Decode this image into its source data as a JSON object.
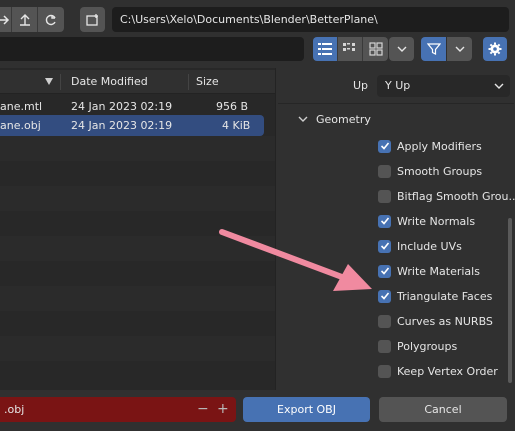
{
  "toolbar": {
    "path": "C:\\Users\\Xelo\\Documents\\Blender\\BetterPlane\\",
    "filter_value": ""
  },
  "filelist": {
    "columns": [
      "Date Modified",
      "Size"
    ],
    "rows": [
      {
        "name": "ane.mtl",
        "date": "24 Jan 2023 02:19",
        "size": "956 B",
        "selected": false
      },
      {
        "name": "ane.obj",
        "date": "24 Jan 2023 02:19",
        "size": "4 KiB",
        "selected": true
      }
    ]
  },
  "sidepanel": {
    "up_label": "Up",
    "up_value": "Y Up",
    "section_title": "Geometry",
    "options": [
      {
        "label": "Apply Modifiers",
        "checked": true
      },
      {
        "label": "Smooth Groups",
        "checked": false
      },
      {
        "label": "Bitflag Smooth Grou...",
        "checked": false
      },
      {
        "label": "Write Normals",
        "checked": true
      },
      {
        "label": "Include UVs",
        "checked": true
      },
      {
        "label": "Write Materials",
        "checked": true
      },
      {
        "label": "Triangulate Faces",
        "checked": true
      },
      {
        "label": "Curves as NURBS",
        "checked": false
      },
      {
        "label": "Polygroups",
        "checked": false
      },
      {
        "label": "Keep Vertex Order",
        "checked": false
      }
    ]
  },
  "bottom": {
    "filename": ".obj",
    "minus": "−",
    "plus": "+",
    "export_label": "Export OBJ",
    "cancel_label": "Cancel"
  },
  "colors": {
    "accent": "#4772b3",
    "selected_row": "#334d80",
    "filename_error": "#7a1414",
    "annotation_arrow": "#f08aa0"
  },
  "icons": [
    "forward-icon",
    "parent-folder-icon",
    "refresh-icon",
    "new-folder-icon",
    "list-view-icon",
    "thumbnail-list-icon",
    "grid-view-icon",
    "chevron-down-icon",
    "filter-icon",
    "gear-icon",
    "sort-desc-icon",
    "checkmark-icon"
  ]
}
